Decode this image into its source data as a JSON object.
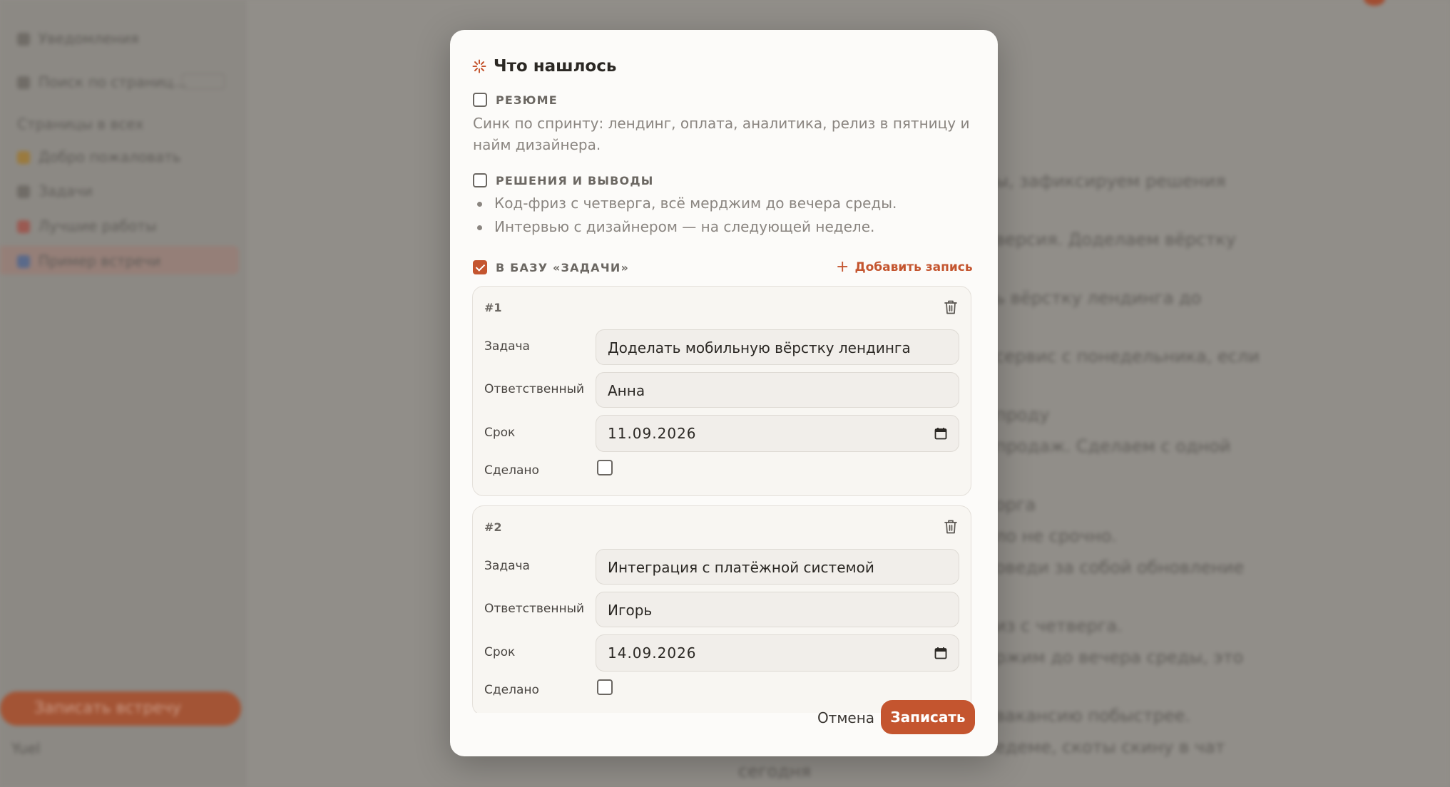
{
  "background": {
    "sidebar_items": [
      {
        "label": "Уведомления"
      },
      {
        "label": "Поиск по страниц..."
      },
      {
        "label": "Страницы в всех"
      },
      {
        "label": "Добро пожаловать"
      },
      {
        "label": "Задачи"
      },
      {
        "label": "Лучшие работы"
      },
      {
        "label": "Пример встречи"
      }
    ],
    "new_meeting_button": "Записать встречу",
    "user_name": "Yuel",
    "main_lines": [
      "ы, зафиксируем решения",
      "версия. Доделаем вёрстку",
      "ь вёрстку лендинга до",
      "сервис с понедельника, если",
      "проду",
      "продаж. Сделаем с одной",
      "орга",
      "ло не срочно.",
      "оведи за собой обновление",
      "из с четверга.",
      "ржим до вечера среды, это",
      "вакансию побыстрее.",
      "едеме, скоты скину в чат",
      "сегодня"
    ]
  },
  "modal": {
    "title": "Что нашлось",
    "summary": {
      "label": "РЕЗЮМЕ",
      "checked": false,
      "text": "Синк по спринту: лендинг, оплата, аналитика, релиз в пятницу и найм дизайнера."
    },
    "decisions": {
      "label": "РЕШЕНИЯ И ВЫВОДЫ",
      "checked": false,
      "items": [
        "Код-фриз с четверга, всё мерджим до вечера среды.",
        "Интервью с дизайнером — на следующей неделе."
      ]
    },
    "database": {
      "label": "В БАЗУ «ЗАДАЧИ»",
      "checked": true,
      "add_record_label": "Добавить запись",
      "field_labels": {
        "task": "Задача",
        "assignee": "Ответственный",
        "due": "Срок",
        "done": "Сделано"
      },
      "records": [
        {
          "num": "#1",
          "task": "Доделать мобильную вёрстку лендинга",
          "assignee": "Анна",
          "due": "11.09.2026",
          "done": false
        },
        {
          "num": "#2",
          "task": "Интеграция с платёжной системой",
          "assignee": "Игорь",
          "due": "14.09.2026",
          "done": false
        }
      ]
    },
    "cancel_label": "Отмена",
    "save_label": "Записать"
  },
  "colors": {
    "accent": "#c4552f",
    "modal_bg": "#fcfbf9",
    "overlay": "#8f8c87",
    "muted_text": "#8a8580"
  },
  "icons": [
    "sparkle-icon",
    "checkbox-icon",
    "plus-icon",
    "trash-icon",
    "calendar-icon"
  ]
}
